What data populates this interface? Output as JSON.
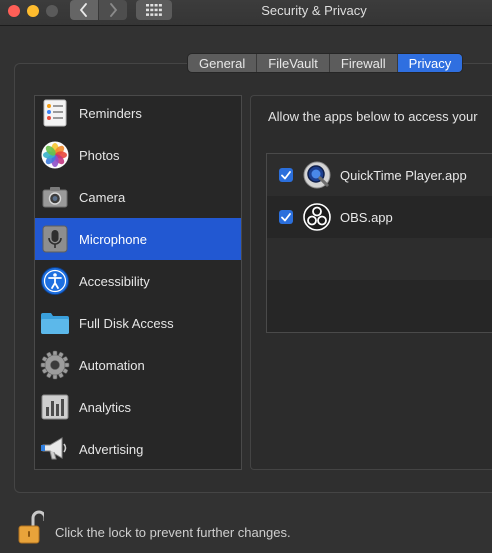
{
  "window": {
    "title": "Security & Privacy"
  },
  "tabs": [
    {
      "label": "General",
      "active": false
    },
    {
      "label": "FileVault",
      "active": false
    },
    {
      "label": "Firewall",
      "active": false
    },
    {
      "label": "Privacy",
      "active": true
    }
  ],
  "sidebar": {
    "items": [
      {
        "label": "Reminders",
        "icon": "reminders-icon",
        "selected": false
      },
      {
        "label": "Photos",
        "icon": "photos-icon",
        "selected": false
      },
      {
        "label": "Camera",
        "icon": "camera-icon",
        "selected": false
      },
      {
        "label": "Microphone",
        "icon": "microphone-icon",
        "selected": true
      },
      {
        "label": "Accessibility",
        "icon": "accessibility-icon",
        "selected": false
      },
      {
        "label": "Full Disk Access",
        "icon": "folder-icon",
        "selected": false
      },
      {
        "label": "Automation",
        "icon": "gear-icon",
        "selected": false
      },
      {
        "label": "Analytics",
        "icon": "analytics-icon",
        "selected": false
      },
      {
        "label": "Advertising",
        "icon": "megaphone-icon",
        "selected": false
      }
    ]
  },
  "panel": {
    "description": "Allow the apps below to access your",
    "apps": [
      {
        "name": "QuickTime Player.app",
        "checked": true,
        "icon": "quicktime-icon"
      },
      {
        "name": "OBS.app",
        "checked": true,
        "icon": "obs-icon"
      }
    ]
  },
  "footer": {
    "lock_text": "Click the lock to prevent further changes."
  },
  "colors": {
    "accent": "#2258d2",
    "tab_active": "#2f6fe0",
    "background": "#323232"
  }
}
